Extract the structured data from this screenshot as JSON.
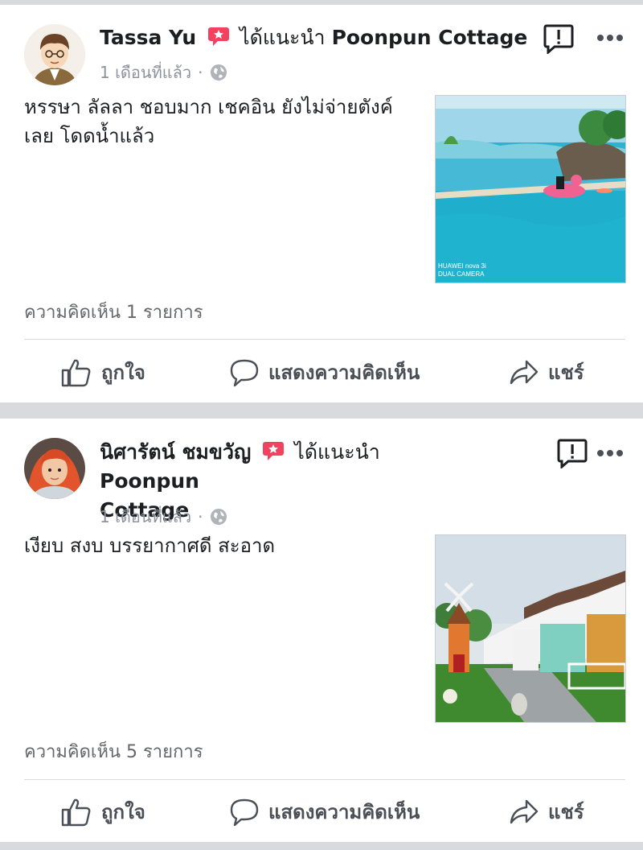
{
  "posts": [
    {
      "author": "Tassa Yu",
      "recommend_text": "ได้แนะนำ",
      "page_name": "Poonpun Cottage",
      "page_name_line2": "",
      "time": "1 เดือนที่แล้ว",
      "text": "หรรษา ลัลลา ชอบมาก เชคอิน ยังไม่จ่ายตังค์เลย โดดน้ำแล้ว",
      "photo_watermark_1": "HUAWEI nova 3i",
      "photo_watermark_2": "DUAL CAMERA",
      "comments": "ความคิดเห็น 1 รายการ",
      "actions": {
        "like": "ถูกใจ",
        "comment": "แสดงความคิดเห็น",
        "share": "แชร์"
      }
    },
    {
      "author": "นิศารัตน์ ชมขวัญ",
      "recommend_text": "ได้แนะนำ",
      "page_name": "Poonpun",
      "page_name_line2": "Cottage",
      "time": "1 เดือนที่แล้ว",
      "text": "เงียบ สงบ บรรยากาศดี สะอาด",
      "comments": "ความคิดเห็น 5 รายการ",
      "actions": {
        "like": "ถูกใจ",
        "comment": "แสดงความคิดเห็น",
        "share": "แชร์"
      }
    }
  ],
  "colors": {
    "text": "#1c1e21",
    "muted": "#8d949e",
    "recommend": "#f3425f",
    "separator": "#d9dadd"
  },
  "icons": [
    "recommend-icon",
    "globe-icon",
    "report-icon",
    "more-icon",
    "like-icon",
    "comment-icon",
    "share-icon"
  ]
}
